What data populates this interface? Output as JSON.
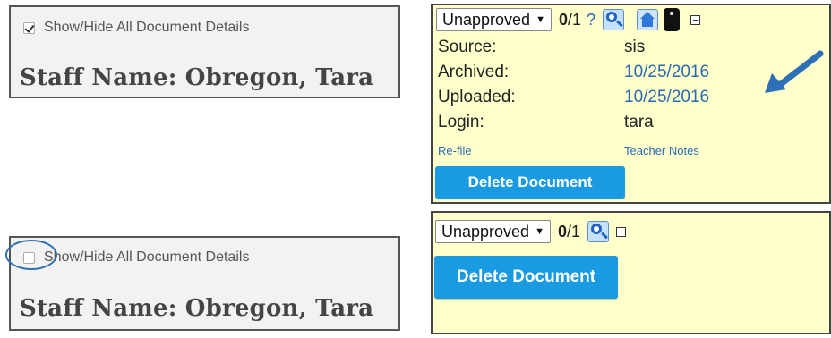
{
  "staff_panel_top": {
    "toggle_label": "Show/Hide All Document Details",
    "toggle_checked": true,
    "staff_name": "Staff Name: Obregon, Tara"
  },
  "staff_panel_bottom": {
    "toggle_label": "Show/Hide All Document Details",
    "toggle_checked": false,
    "staff_name": "Staff Name: Obregon, Tara"
  },
  "doc_panel_expanded": {
    "status_value": "Unapproved",
    "count_current": "0",
    "count_total": "/1",
    "help_label": "?",
    "details": [
      {
        "label": "Source:",
        "value": "sis",
        "is_link": false
      },
      {
        "label": "Archived:",
        "value": "10/25/2016",
        "is_link": true
      },
      {
        "label": "Uploaded:",
        "value": "10/25/2016",
        "is_link": true
      },
      {
        "label": "Login:",
        "value": "tara",
        "is_link": false
      }
    ],
    "refile_link": "Re-file",
    "teacher_notes_link": "Teacher Notes",
    "delete_label": "Delete Document"
  },
  "doc_panel_collapsed": {
    "status_value": "Unapproved",
    "count_current": "0",
    "count_total": "/1",
    "delete_label": "Delete Document"
  },
  "colors": {
    "panel_yellow": "#ffffcc",
    "button_blue": "#1a9ae0",
    "link_blue": "#2a6ab5",
    "annotation_blue": "#2f6fb5"
  },
  "icons": {
    "view": "magnifier-icon",
    "home": "house-icon",
    "notes": "note-icon",
    "collapse": "collapse-box-icon",
    "expand": "expand-box-icon",
    "annotation_arrow": "arrow-icon",
    "annotation_circle": "circle-highlight"
  }
}
